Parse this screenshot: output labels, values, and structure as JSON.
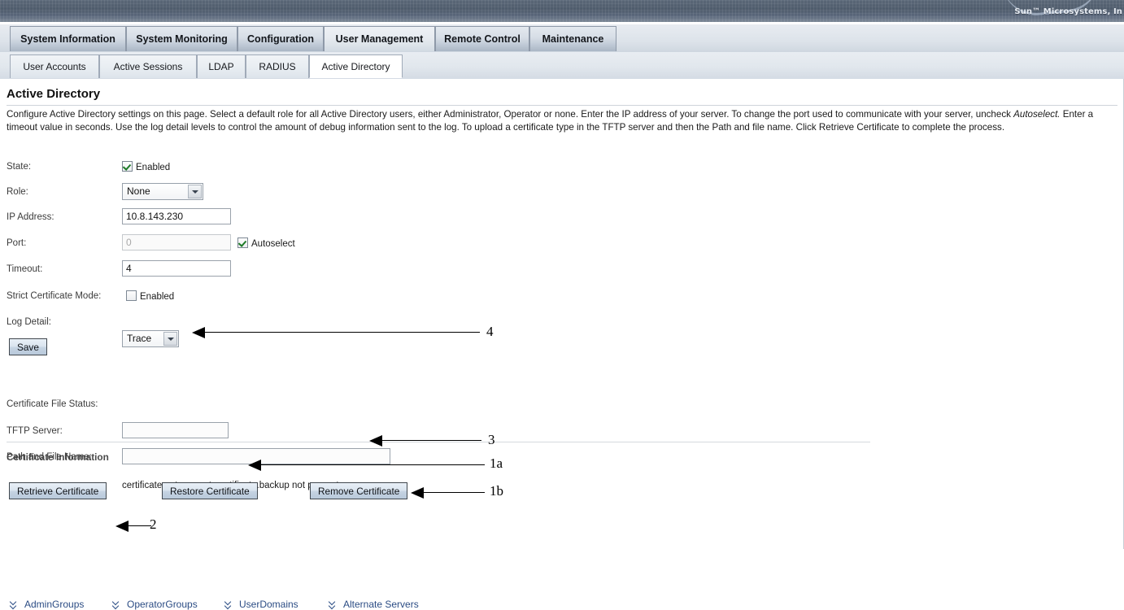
{
  "brand": {
    "text": "Sun™ Microsystems, In"
  },
  "primary_tabs": [
    {
      "label": "System Information",
      "active": false
    },
    {
      "label": "System Monitoring",
      "active": false
    },
    {
      "label": "Configuration",
      "active": false
    },
    {
      "label": "User Management",
      "active": true
    },
    {
      "label": "Remote Control",
      "active": false
    },
    {
      "label": "Maintenance",
      "active": false
    }
  ],
  "secondary_tabs": [
    {
      "label": "User Accounts",
      "active": false
    },
    {
      "label": "Active Sessions",
      "active": false
    },
    {
      "label": "LDAP",
      "active": false
    },
    {
      "label": "RADIUS",
      "active": false
    },
    {
      "label": "Active Directory",
      "active": true
    }
  ],
  "page": {
    "title": "Active Directory",
    "description_part1": "Configure Active Directory settings on this page. Select a default role for all Active Directory users, either Administrator, Operator or none. Enter the IP address of your server. To change the port used to communicate with your server, uncheck ",
    "description_italic": "Autoselect.",
    "description_part2": " Enter a timeout value in seconds. Use the log detail levels to control the amount of debug information sent to the log. To upload a certificate type in the TFTP server and then the Path and file name. Click Retrieve Certificate to complete the process."
  },
  "form": {
    "state_label": "State:",
    "state_checkbox_label": "Enabled",
    "state_checked": true,
    "role_label": "Role:",
    "role_value": "None",
    "ip_label": "IP Address:",
    "ip_value": "10.8.143.230",
    "port_label": "Port:",
    "port_value": "0",
    "port_disabled": true,
    "autoselect_label": "Autoselect",
    "autoselect_checked": true,
    "timeout_label": "Timeout:",
    "timeout_value": "4",
    "strict_label": "Strict Certificate Mode:",
    "strict_checkbox_label": "Enabled",
    "strict_checked": false,
    "log_detail_label": "Log Detail:",
    "log_detail_value": "Trace",
    "save_label": "Save"
  },
  "certificate": {
    "section_title": "Certificate Information",
    "file_status_label": "Certificate File Status:",
    "file_status_value": "certificate not present; certificate.backup not present;",
    "tftp_label": "TFTP Server:",
    "tftp_value": "",
    "path_label": "Path and File Name:",
    "path_value": "",
    "retrieve_label": "Retrieve Certificate",
    "restore_label": "Restore Certificate",
    "remove_label": "Remove Certificate"
  },
  "expanders": [
    {
      "label": "AdminGroups"
    },
    {
      "label": "OperatorGroups"
    },
    {
      "label": "UserDomains"
    },
    {
      "label": "Alternate Servers"
    }
  ],
  "annotations": [
    {
      "id": "4",
      "text": "4"
    },
    {
      "id": "3",
      "text": "3"
    },
    {
      "id": "1a",
      "text": "1a"
    },
    {
      "id": "1b",
      "text": "1b"
    },
    {
      "id": "2",
      "text": "2"
    }
  ],
  "colors": {
    "brand_bar": "#4f5c6c",
    "tab_active": "#eef1f5",
    "link_blue": "#2b4c84",
    "check_green": "#1d7a27"
  }
}
